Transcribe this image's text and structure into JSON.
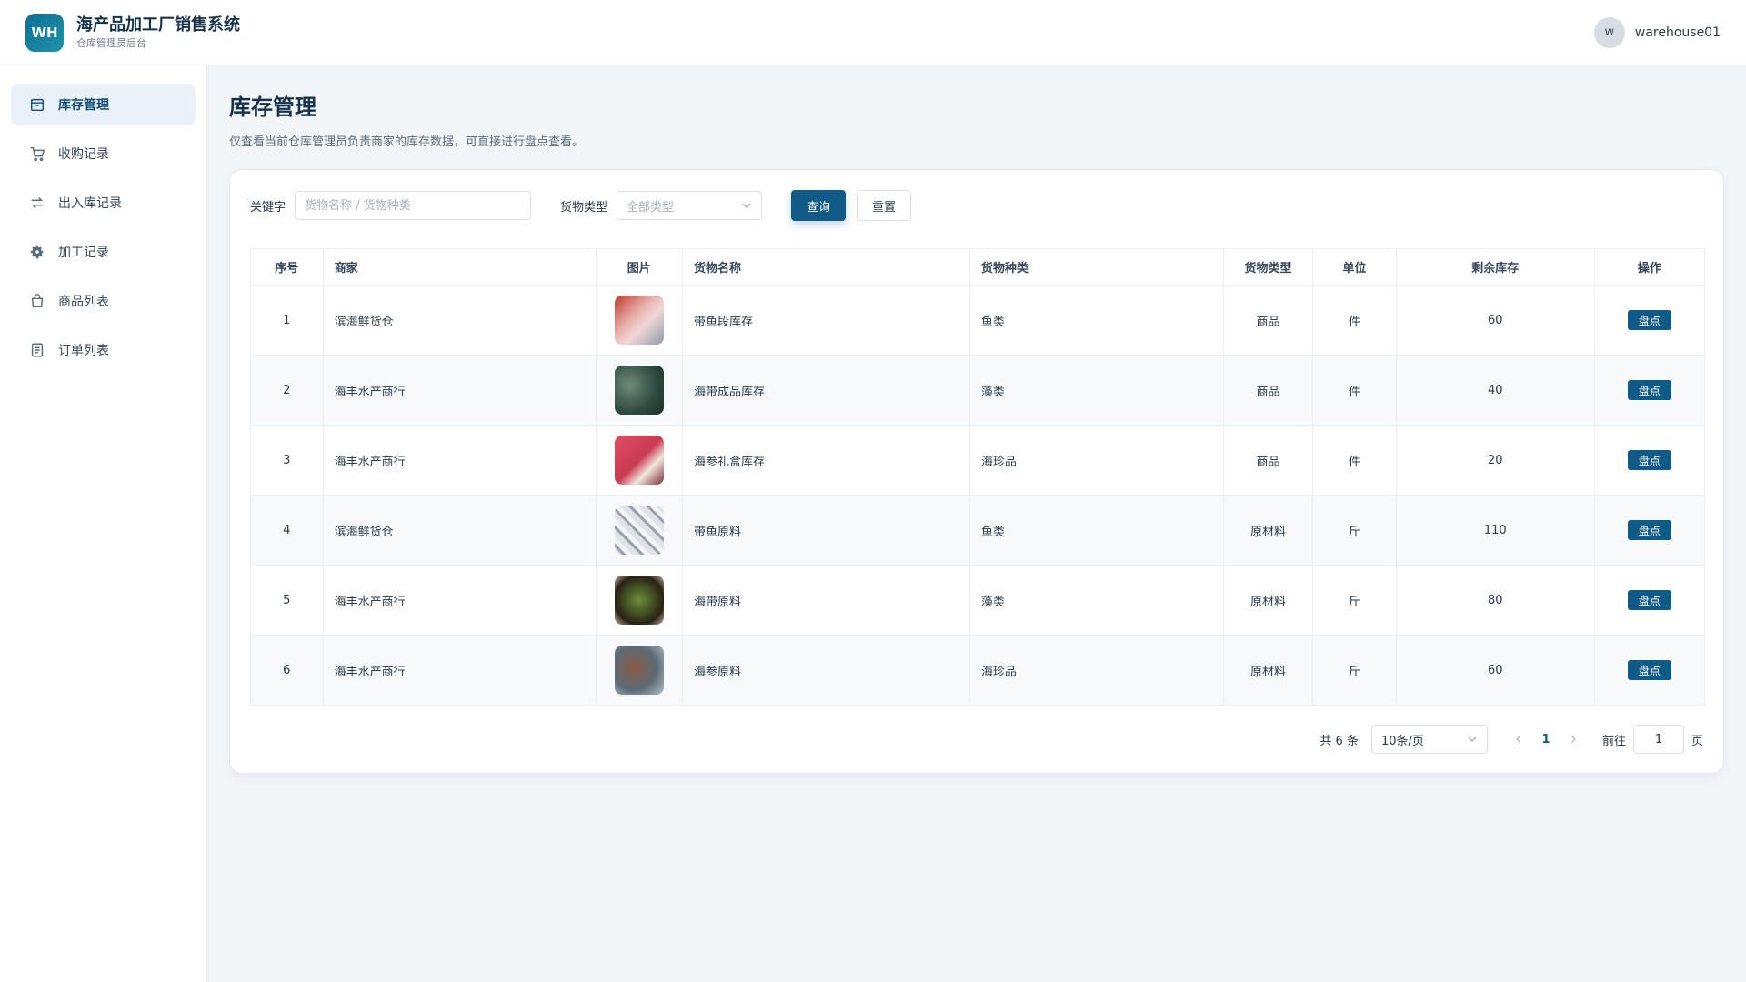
{
  "app": {
    "logo_text": "WH",
    "title": "海产品加工厂销售系统",
    "subtitle": "仓库管理员后台",
    "user_initial": "w",
    "username": "warehouse01"
  },
  "sidebar": {
    "items": [
      {
        "label": "库存管理",
        "icon": "box-icon",
        "active": true
      },
      {
        "label": "收购记录",
        "icon": "cart-icon",
        "active": false
      },
      {
        "label": "出入库记录",
        "icon": "transfer-icon",
        "active": false
      },
      {
        "label": "加工记录",
        "icon": "gear-icon",
        "active": false
      },
      {
        "label": "商品列表",
        "icon": "bag-icon",
        "active": false
      },
      {
        "label": "订单列表",
        "icon": "document-icon",
        "active": false
      }
    ]
  },
  "page": {
    "title": "库存管理",
    "description": "仅查看当前仓库管理员负责商家的库存数据，可直接进行盘点查看。"
  },
  "filters": {
    "keyword_label": "关键字",
    "keyword_placeholder": "货物名称 / 货物种类",
    "type_label": "货物类型",
    "type_placeholder": "全部类型",
    "query_button": "查询",
    "reset_button": "重置"
  },
  "table": {
    "columns": [
      "序号",
      "商家",
      "图片",
      "货物名称",
      "货物种类",
      "货物类型",
      "单位",
      "剩余库存",
      "操作"
    ],
    "rows": [
      {
        "index": "1",
        "merchant": "滨海鲜货仓",
        "name": "带鱼段库存",
        "category": "鱼类",
        "type": "商品",
        "unit": "件",
        "stock": "60",
        "action": "盘点"
      },
      {
        "index": "2",
        "merchant": "海丰水产商行",
        "name": "海带成品库存",
        "category": "藻类",
        "type": "商品",
        "unit": "件",
        "stock": "40",
        "action": "盘点"
      },
      {
        "index": "3",
        "merchant": "海丰水产商行",
        "name": "海参礼盒库存",
        "category": "海珍品",
        "type": "商品",
        "unit": "件",
        "stock": "20",
        "action": "盘点"
      },
      {
        "index": "4",
        "merchant": "滨海鲜货仓",
        "name": "带鱼原料",
        "category": "鱼类",
        "type": "原材料",
        "unit": "斤",
        "stock": "110",
        "action": "盘点"
      },
      {
        "index": "5",
        "merchant": "海丰水产商行",
        "name": "海带原料",
        "category": "藻类",
        "type": "原材料",
        "unit": "斤",
        "stock": "80",
        "action": "盘点"
      },
      {
        "index": "6",
        "merchant": "海丰水产商行",
        "name": "海参原料",
        "category": "海珍品",
        "type": "原材料",
        "unit": "斤",
        "stock": "60",
        "action": "盘点"
      }
    ]
  },
  "pagination": {
    "total": "共 6 条",
    "page_size": "10条/页",
    "current_page": "1",
    "goto_label": "前往",
    "goto_value": "1",
    "page_suffix": "页"
  },
  "colors": {
    "primary": "#0f5a86",
    "active_nav_bg": "#eaf1f7",
    "background": "#f3f6f9"
  }
}
